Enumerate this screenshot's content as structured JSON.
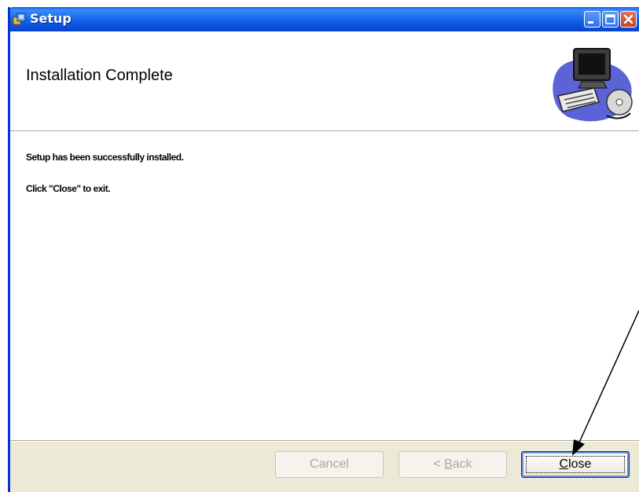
{
  "window": {
    "title": "Setup",
    "controls": [
      "minimize-icon",
      "maximize-icon",
      "close-icon"
    ]
  },
  "header": {
    "title": "Installation Complete",
    "graphic": "computer-with-cd-icon"
  },
  "content": {
    "line1": "Setup has been successfully installed.",
    "line2": "Click \"Close\" to exit."
  },
  "buttons": {
    "cancel": "Cancel",
    "back_prefix": "< ",
    "back_mnemonic": "B",
    "back_rest": "ack",
    "close_mnemonic": "C",
    "close_rest": "lose"
  },
  "annotation": {
    "type": "arrow-pointing-to-close-button"
  },
  "colors": {
    "titlebar": "#0a5ee8",
    "dialog_face": "#ece9d8",
    "disabled_text": "#aca899"
  }
}
